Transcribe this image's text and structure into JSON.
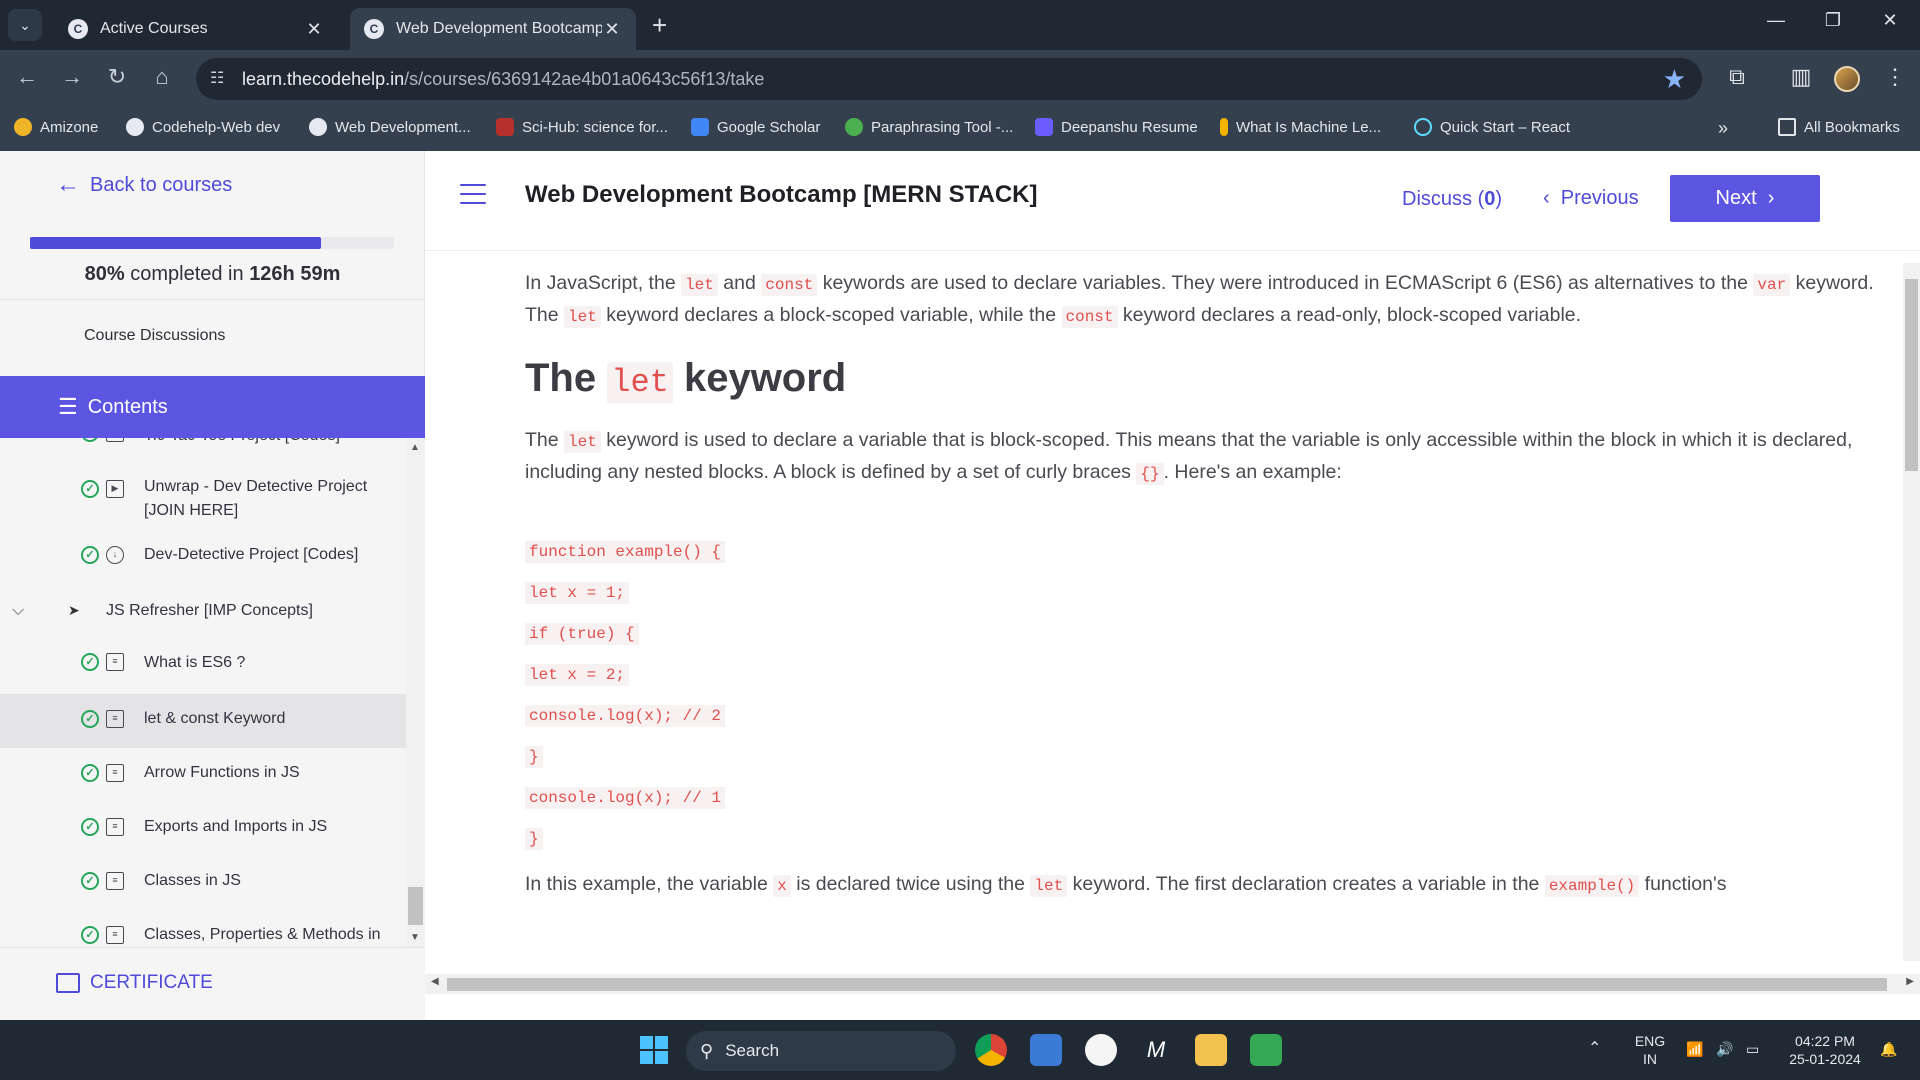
{
  "browser": {
    "tabs": [
      {
        "title": "Active Courses",
        "active": false
      },
      {
        "title": "Web Development Bootcamp [M",
        "active": true
      }
    ],
    "url_host": "learn.thecodehelp.in",
    "url_path": "/s/courses/6369142ae4b01a0643c56f13/take",
    "bookmarks": [
      "Amizone",
      "Codehelp-Web dev",
      "Web Development...",
      "Sci-Hub: science for...",
      "Google Scholar",
      "Paraphrasing Tool -...",
      "Deepanshu Resume",
      "What Is Machine Le...",
      "Quick Start – React"
    ],
    "all_bookmarks": "All Bookmarks"
  },
  "sidebar": {
    "back_label": "Back to courses",
    "progress_percent": 80,
    "progress_pct_text": "80%",
    "progress_mid": " completed in ",
    "progress_time": "126h 59m",
    "discussions": "Course Discussions",
    "contents_label": "Contents",
    "lessons": [
      {
        "name": "Tic-Tac-Toe Project [Codes]"
      },
      {
        "name": "Unwrap - Dev Detective Project [JOIN HERE]"
      },
      {
        "name": "Dev-Detective Project [Codes]"
      },
      {
        "name": "JS Refresher [IMP Concepts]"
      },
      {
        "name": "What is ES6 ?"
      },
      {
        "name": "let & const Keyword"
      },
      {
        "name": "Arrow Functions in JS"
      },
      {
        "name": "Exports and Imports in JS"
      },
      {
        "name": "Classes in JS"
      },
      {
        "name": "Classes, Properties & Methods in"
      }
    ],
    "certificate": "CERTIFICATE"
  },
  "main": {
    "course_title": "Web Development Bootcamp [MERN STACK]",
    "discuss_label": "Discuss (",
    "discuss_count": "0",
    "discuss_close": ")",
    "previous_label": "Previous",
    "next_label": "Next",
    "intro": {
      "t1": "In JavaScript, the ",
      "c1": "let",
      "t2": " and ",
      "c2": "const",
      "t3": " keywords are used to declare variables. They were introduced in ECMAScript 6 (ES6) as alternatives to the ",
      "c3": "var",
      "t4": " keyword. The ",
      "c4": "let",
      "t5": " keyword declares a block-scoped variable, while the ",
      "c5": "const",
      "t6": " keyword declares a read-only, block-scoped variable."
    },
    "heading": {
      "pre": "The ",
      "code": "let",
      "post": " keyword"
    },
    "para2": {
      "t1": "The ",
      "c1": "let",
      "t2": " keyword is used to declare a variable that is block-scoped. This means that the variable is only accessible within the block in which it is declared, including any nested blocks. A block is defined by a set of curly braces ",
      "c2": "{}",
      "t3": ". Here's an example:"
    },
    "code_lines": [
      "function example() {",
      "let x = 1;",
      "if (true) {",
      "let x = 2;",
      "console.log(x); // 2",
      "}",
      "console.log(x); // 1",
      "}"
    ],
    "para3": {
      "t1": "In this example, the variable ",
      "c1": "x",
      "t2": " is declared twice using the ",
      "c2": "let",
      "t3": " keyword. The first declaration creates a variable in the ",
      "c3": "example()",
      "t4": " function's"
    }
  },
  "taskbar": {
    "search_placeholder": "Search",
    "lang": "ENG",
    "region": "IN",
    "time": "04:22 PM",
    "date": "25-01-2024"
  }
}
